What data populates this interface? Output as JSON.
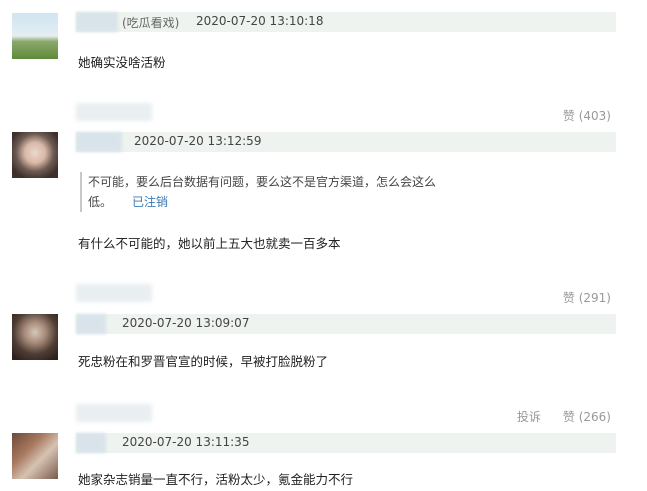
{
  "comments": [
    {
      "nickname": "(吃瓜看戏)",
      "time": "2020-07-20 13:10:18",
      "text": "她确实没啥活粉",
      "likes_label": "赞 (403)"
    },
    {
      "time": "2020-07-20 13:12:59",
      "quote_line1": "不可能，要么后台数据有问题，要么这不是官方渠道，怎么会这么",
      "quote_line2": "低。",
      "quote_link": "已注销",
      "text": "有什么不可能的，她以前上五大也就卖一百多本",
      "likes_label": "赞 (291)"
    },
    {
      "time": "2020-07-20 13:09:07",
      "text": "死忠粉在和罗晋官宣的时候，早被打脸脱粉了",
      "report_label": "投诉",
      "likes_label": "赞 (266)"
    },
    {
      "time": "2020-07-20 13:11:35",
      "text": "她家杂志销量一直不行，活粉太少，氪金能力不行"
    }
  ]
}
